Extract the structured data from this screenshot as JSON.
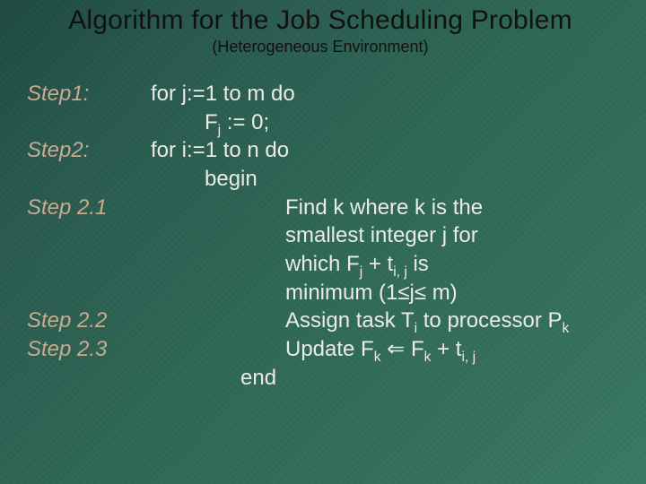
{
  "title": "Algorithm for the  Job Scheduling Problem",
  "subtitle": "(Heterogeneous Environment)",
  "steps": {
    "s1": "Step1:",
    "s2": "Step2:",
    "s21": "Step 2.1",
    "s22": "Step 2.2",
    "s23": "Step 2.3"
  },
  "code": {
    "l1": "for j:=1 to m do",
    "l2_pre": "F",
    "l2_sub": "j",
    "l2_post": " := 0;",
    "l3": "for i:=1 to n do",
    "l4": "begin",
    "l5a": "Find k where k is the",
    "l5b": "smallest integer j for",
    "l5c_pre": "which F",
    "l5c_sub1": "j",
    "l5c_mid": " + t",
    "l5c_sub2": "i, j",
    "l5c_post": " is",
    "l5d": "minimum (1≤j≤  m)",
    "l6_pre": "Assign task T",
    "l6_sub1": "i",
    "l6_mid": " to processor P",
    "l6_sub2": "k",
    "l7_pre": "Update F",
    "l7_sub1": "k",
    "l7_arrow": " ⇐ ",
    "l7_mid": "F",
    "l7_sub2": "k",
    "l7_mid2": " + t",
    "l7_sub3": "i, j",
    "l8": "end"
  }
}
